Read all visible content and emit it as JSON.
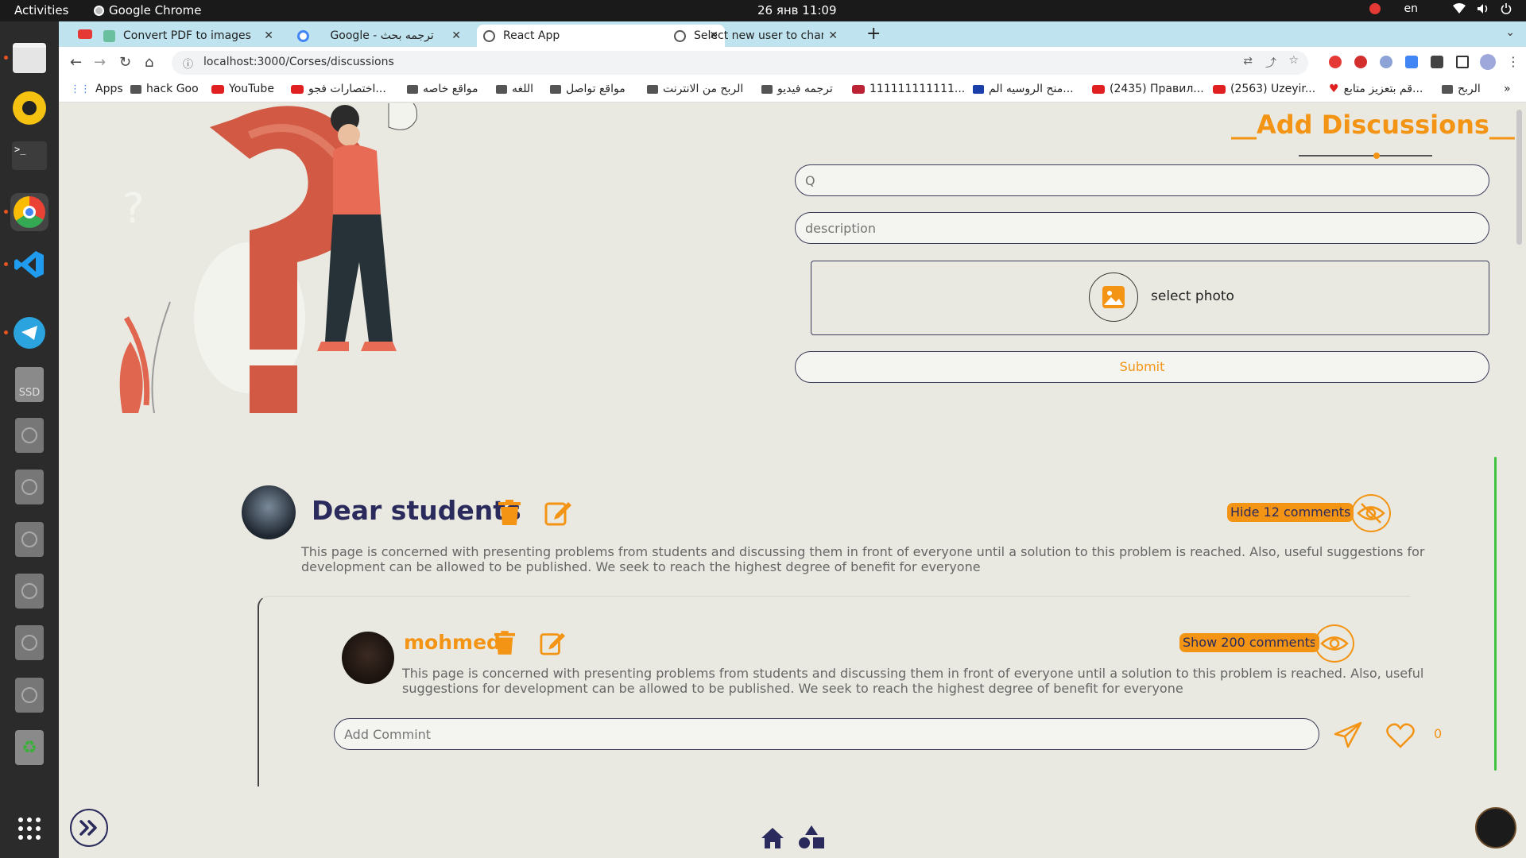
{
  "system": {
    "activities": "Activities",
    "app_name": "Google Chrome",
    "clock": "26 янв  11:09",
    "lang": "en"
  },
  "tabs": [
    {
      "title": "Convert PDF to images",
      "color": "#e53935"
    },
    {
      "title": "Google - ترجمه بحث",
      "color": "#4285f4"
    },
    {
      "title": "React App",
      "color": "#444444"
    },
    {
      "title": "Select new user to chang",
      "color": "#444444"
    }
  ],
  "url": "localhost:3000/Corses/discussions",
  "bookmarks": [
    "Apps",
    "hack Goo",
    "YouTube",
    "اختصارات فجو...",
    "مواقع خاصه",
    "اللغه",
    "مواقع تواصل",
    "الربح من الانترنت",
    "ترجمه فيديو",
    "111111111111...",
    "منح الروسيه الم...",
    "(2435) Правил...",
    "(2563) Uzeyir...",
    "قم بتعزيز متابع...",
    "الربح"
  ],
  "form": {
    "title": "__Add Discussions__",
    "question_placeholder": "Q",
    "description_placeholder": "description",
    "select_photo": "select photo",
    "submit": "Submit"
  },
  "post": {
    "title": "Dear students",
    "toggle_label": "Hide 12 comments",
    "text": "This page is concerned with presenting problems from students and discussing them in front of everyone until a solution to this problem is reached. Also, useful suggestions for development can be allowed to be published. We seek to reach the highest degree of benefit for everyone"
  },
  "comment": {
    "author": "mohmed",
    "toggle_label": "Show 200 comments",
    "text": "This page is concerned with presenting problems from students and discussing them in front of everyone until a solution to this problem is reached. Also, useful suggestions for development can be allowed to be published. We seek to reach the highest degree of benefit for everyone",
    "add_placeholder": "Add Commint",
    "likes": "0"
  },
  "colors": {
    "accent": "#f39414",
    "navy": "#2a2a5c",
    "page_bg": "#e9e9e1"
  }
}
